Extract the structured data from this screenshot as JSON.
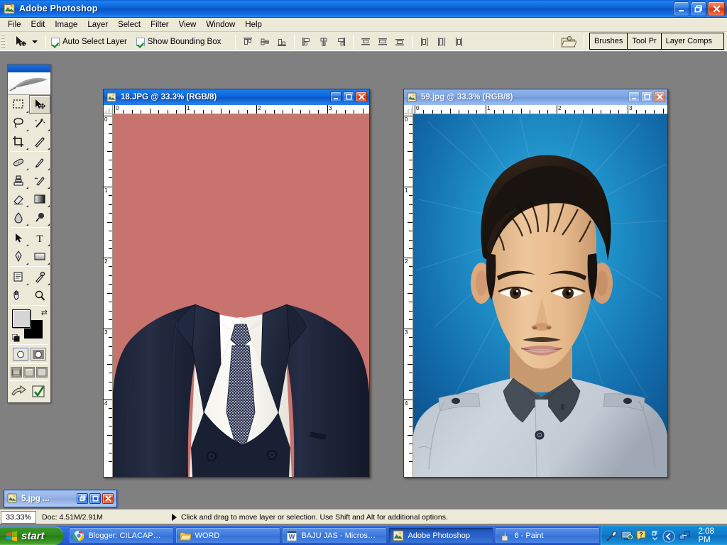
{
  "app": {
    "title": "Adobe Photoshop",
    "icon": "photoshop-icon",
    "window_controls": {
      "minimize": "minimize-icon",
      "restore": "restore-icon",
      "close": "close-icon"
    }
  },
  "menubar": {
    "items": [
      {
        "label": "File"
      },
      {
        "label": "Edit"
      },
      {
        "label": "Image"
      },
      {
        "label": "Layer"
      },
      {
        "label": "Select"
      },
      {
        "label": "Filter"
      },
      {
        "label": "View"
      },
      {
        "label": "Window"
      },
      {
        "label": "Help"
      }
    ]
  },
  "options_bar": {
    "active_tool": "move-tool",
    "checkboxes": [
      {
        "label": "Auto Select Layer",
        "checked": true
      },
      {
        "label": "Show Bounding Box",
        "checked": true
      }
    ],
    "align_buttons": [
      "align-top-edges",
      "align-vertical-centers",
      "align-bottom-edges",
      "align-left-edges",
      "align-horizontal-centers",
      "align-right-edges"
    ],
    "distribute_buttons": [
      "distribute-top-edges",
      "distribute-vertical-centers",
      "distribute-bottom-edges",
      "distribute-left-edges",
      "distribute-horizontal-centers",
      "distribute-right-edges"
    ],
    "file_browser_icon": "file-browser-icon",
    "palette_well": [
      {
        "label": "Brushes"
      },
      {
        "label": "Tool Pr"
      },
      {
        "label": "Layer Comps"
      }
    ]
  },
  "toolbox": {
    "logo": "photoshop-feather-logo",
    "tools": [
      {
        "name": "marquee-tool",
        "selected": false
      },
      {
        "name": "move-tool",
        "selected": true
      },
      {
        "name": "lasso-tool",
        "selected": false
      },
      {
        "name": "magic-wand-tool",
        "selected": false
      },
      {
        "name": "crop-tool",
        "selected": false
      },
      {
        "name": "slice-tool",
        "selected": false
      },
      {
        "name": "healing-brush-tool",
        "selected": false
      },
      {
        "name": "brush-tool",
        "selected": false
      },
      {
        "name": "clone-stamp-tool",
        "selected": false
      },
      {
        "name": "history-brush-tool",
        "selected": false
      },
      {
        "name": "eraser-tool",
        "selected": false
      },
      {
        "name": "gradient-tool",
        "selected": false
      },
      {
        "name": "blur-tool",
        "selected": false
      },
      {
        "name": "dodge-tool",
        "selected": false
      },
      {
        "name": "path-selection-tool",
        "selected": false
      },
      {
        "name": "type-tool",
        "selected": false
      },
      {
        "name": "pen-tool",
        "selected": false
      },
      {
        "name": "shape-tool",
        "selected": false
      },
      {
        "name": "notes-tool",
        "selected": false
      },
      {
        "name": "eyedropper-tool",
        "selected": false
      },
      {
        "name": "hand-tool",
        "selected": false
      },
      {
        "name": "zoom-tool",
        "selected": false
      }
    ],
    "colors": {
      "foreground": "#d6d6d6",
      "background": "#000000"
    },
    "quickmask": [
      "standard-mode",
      "quick-mask-mode"
    ],
    "screen_modes": [
      "standard-screen-mode",
      "full-screen-with-menubar",
      "full-screen-mode"
    ],
    "jump_to": [
      "jump-to-imageready-icon",
      "edit-in-imageready-icon"
    ]
  },
  "documents": [
    {
      "title": "18.JPG @ 33.3% (RGB/8)",
      "active": true,
      "ruler_h": [
        "0",
        "1",
        "2",
        "3"
      ],
      "ruler_v": [
        "0",
        "1",
        "2",
        "3",
        "4"
      ],
      "background_color": "#c9736e",
      "content": "suit-jacket-template-image"
    },
    {
      "title": "59.jpg @ 33.3% (RGB/8)",
      "active": false,
      "ruler_h": [
        "0",
        "1",
        "2",
        "3"
      ],
      "ruler_v": [
        "0",
        "1",
        "2",
        "3",
        "4"
      ],
      "background_color": "#1f85bf",
      "content": "portrait-photo-image"
    }
  ],
  "minimized_document": {
    "title": "5.jpg ...",
    "controls": [
      "restore-icon",
      "maximize-icon",
      "close-icon"
    ]
  },
  "status_bar": {
    "zoom": "33.33%",
    "doc_info": "Doc: 4.51M/2.91M",
    "hint": "Click and drag to move layer or selection.  Use Shift and Alt for additional options."
  },
  "taskbar": {
    "start_label": "start",
    "items": [
      {
        "label": "Blogger: CILACAP…",
        "icon": "chrome-icon",
        "active": false
      },
      {
        "label": "WORD",
        "icon": "folder-icon",
        "active": false
      },
      {
        "label": "BAJU JAS - Micros…",
        "icon": "word-icon",
        "active": false
      },
      {
        "label": "Adobe Photoshop",
        "icon": "photoshop-icon",
        "active": true
      },
      {
        "label": "6 - Paint",
        "icon": "paint-icon",
        "active": false
      }
    ],
    "tray_icons": [
      "microphone-icon",
      "network-icon",
      "help-icon",
      "chevron-expand-icon",
      "back-arrow-icon",
      "network-connection-icon"
    ],
    "time": "2:08 PM"
  },
  "colors": {
    "accent": "#0a55c6",
    "chrome": "#ece9d8",
    "desktop": "#808080",
    "taskbar": "#245bd0",
    "start_green": "#2f8a1d"
  }
}
